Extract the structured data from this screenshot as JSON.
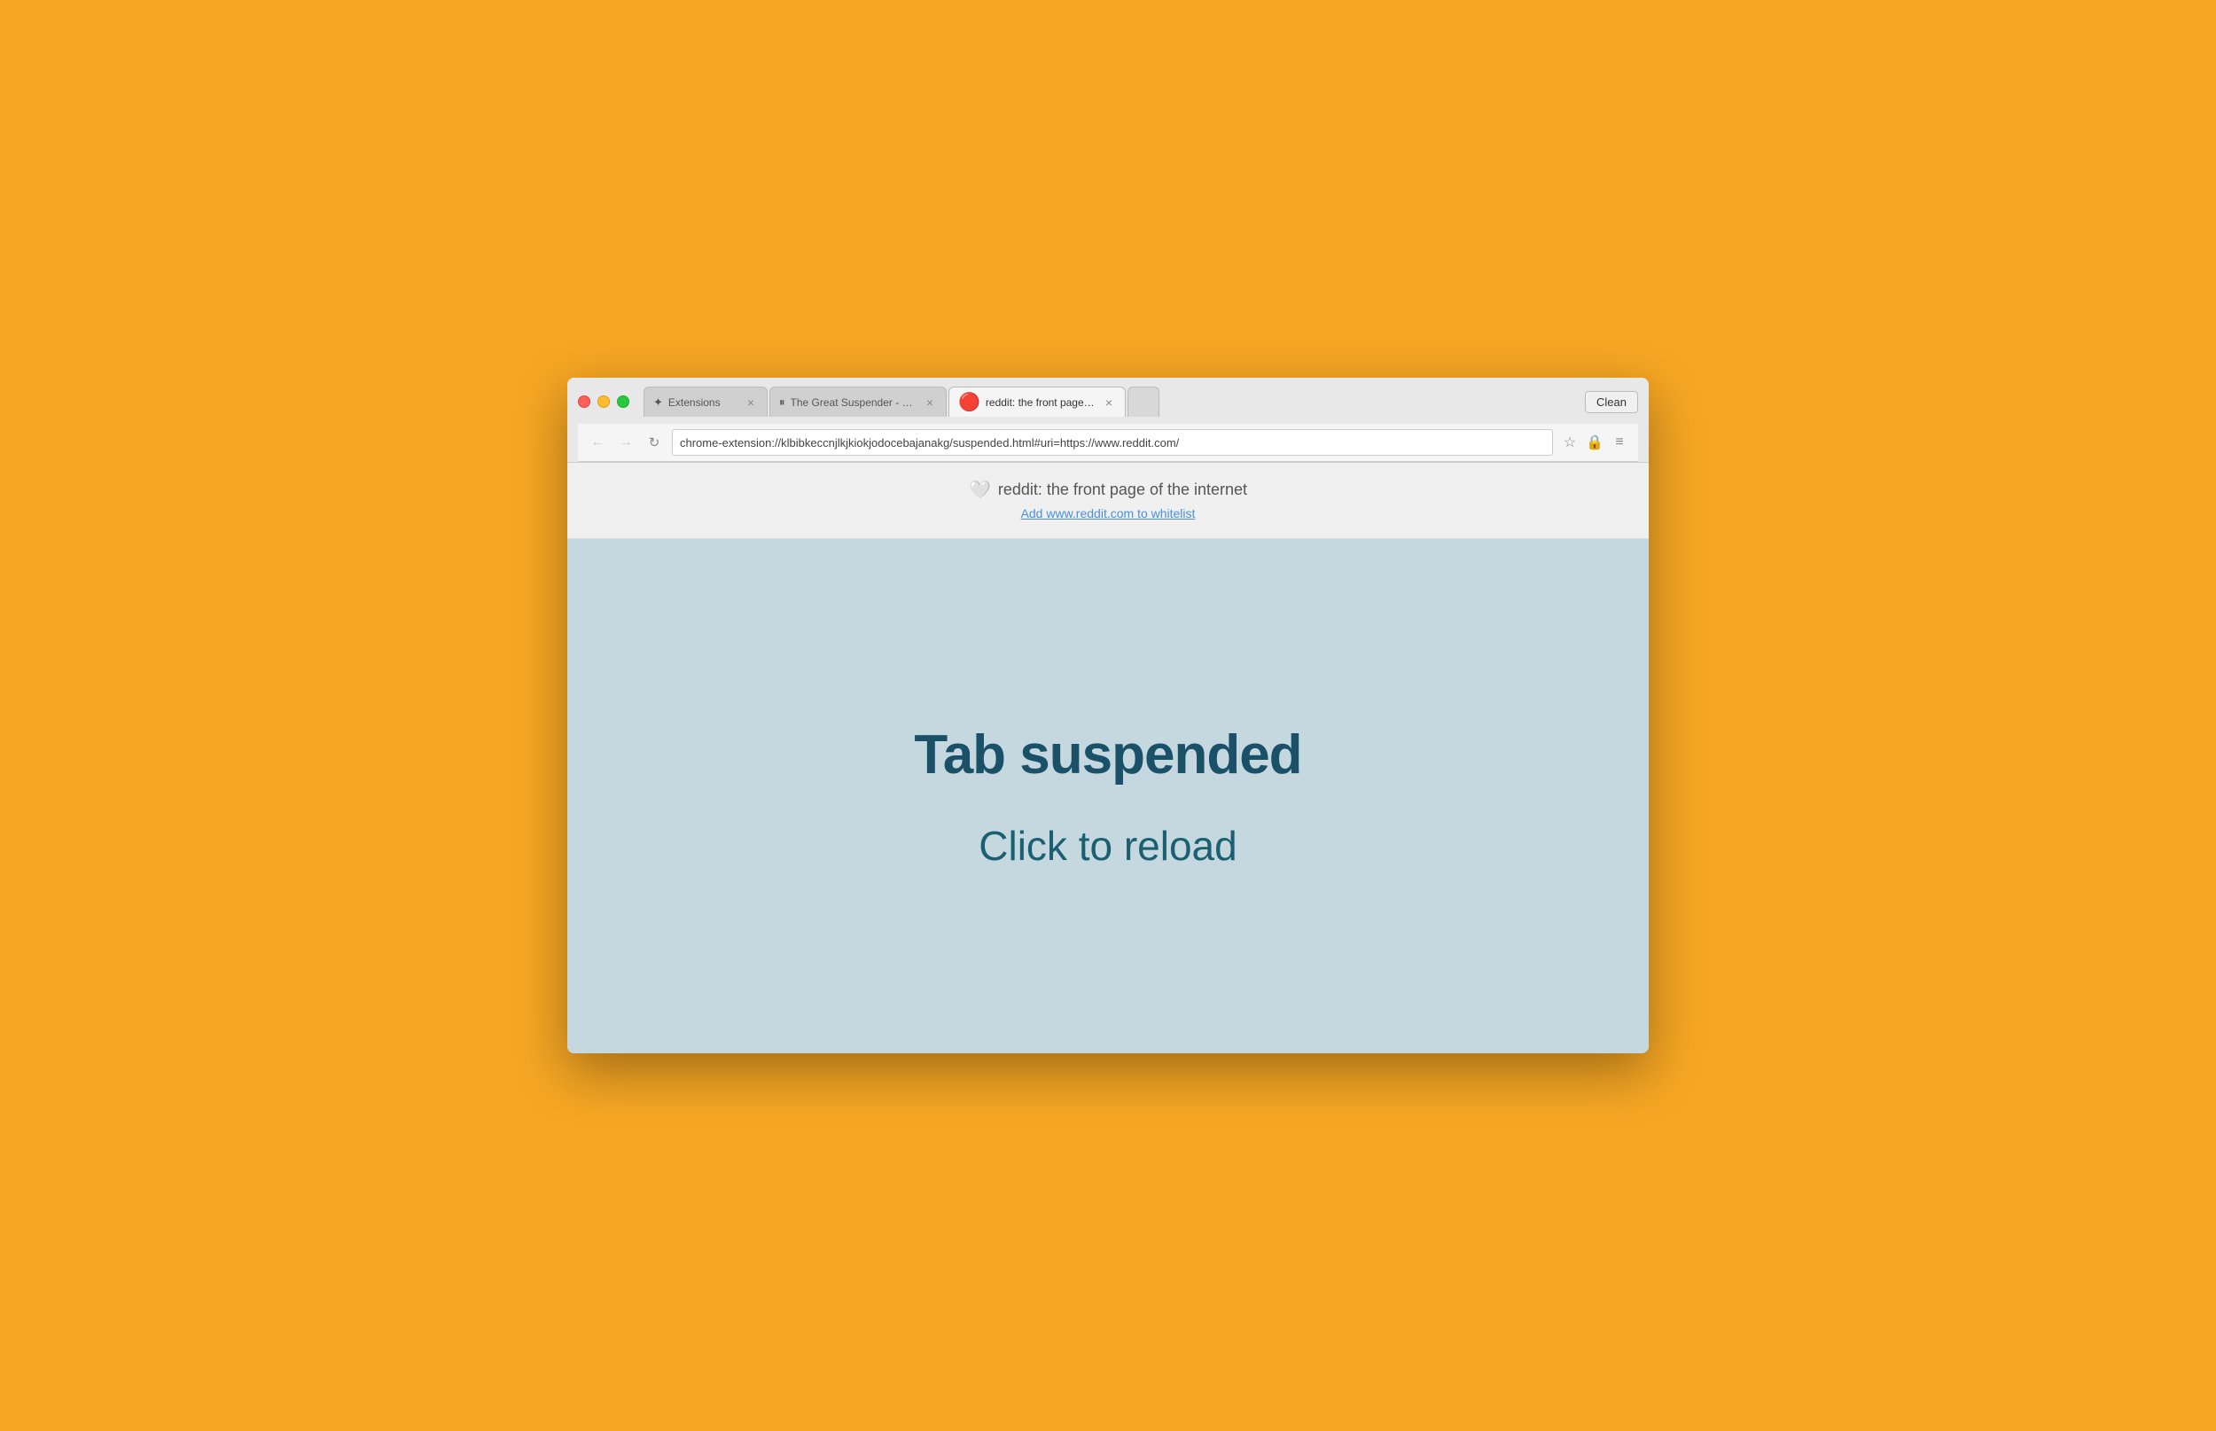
{
  "browser": {
    "clean_button": "Clean",
    "tabs": [
      {
        "id": "tab-extensions",
        "icon": "✦",
        "label": "Extensions",
        "active": false,
        "close": "×"
      },
      {
        "id": "tab-great-suspender",
        "icon": "⏸",
        "label": "The Great Suspender - Ch…",
        "active": false,
        "close": "×"
      },
      {
        "id": "tab-reddit",
        "icon": "🔴",
        "label": "reddit: the front page of th…",
        "active": true,
        "close": "×"
      }
    ],
    "url": "chrome-extension://klbibkeccnjlkjkiokjodocebajanakg/suspended.html#uri=https://www.reddit.com/",
    "nav": {
      "back_disabled": true,
      "forward_disabled": true
    }
  },
  "page_header": {
    "site_title": "reddit: the front page of the internet",
    "whitelist_link": "Add www.reddit.com to whitelist"
  },
  "page_content": {
    "heading": "Tab suspended",
    "subheading": "Click to reload"
  },
  "icons": {
    "back": "←",
    "forward": "→",
    "refresh": "↻",
    "star": "☆",
    "shield": "🔒",
    "menu": "≡"
  }
}
